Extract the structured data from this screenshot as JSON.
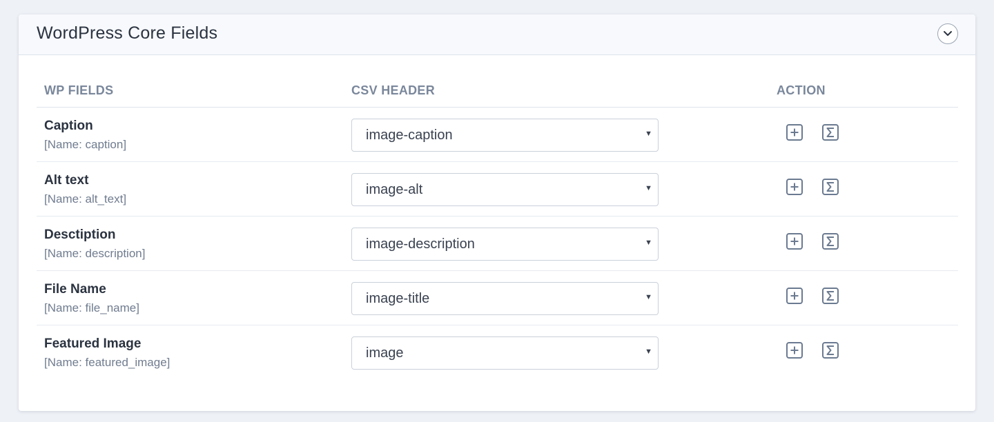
{
  "panel": {
    "title": "WordPress Core Fields"
  },
  "table": {
    "headers": {
      "wp_fields": "WP FIELDS",
      "csv_header": "CSV HEADER",
      "action": "ACTION"
    },
    "rows": [
      {
        "label": "Caption",
        "name": "[Name: caption]",
        "csv_value": "image-caption"
      },
      {
        "label": "Alt text",
        "name": "[Name: alt_text]",
        "csv_value": "image-alt"
      },
      {
        "label": "Desctiption",
        "name": "[Name: description]",
        "csv_value": "image-description"
      },
      {
        "label": "File Name",
        "name": "[Name: file_name]",
        "csv_value": "image-title"
      },
      {
        "label": "Featured Image",
        "name": "[Name: featured_image]",
        "csv_value": "image"
      }
    ]
  },
  "icons": {
    "collapse": "chevron-down-icon",
    "add": "plus-square-icon",
    "formula": "sigma-icon"
  },
  "colors": {
    "header_text": "#7a879b",
    "icon": "#6b7a90"
  }
}
